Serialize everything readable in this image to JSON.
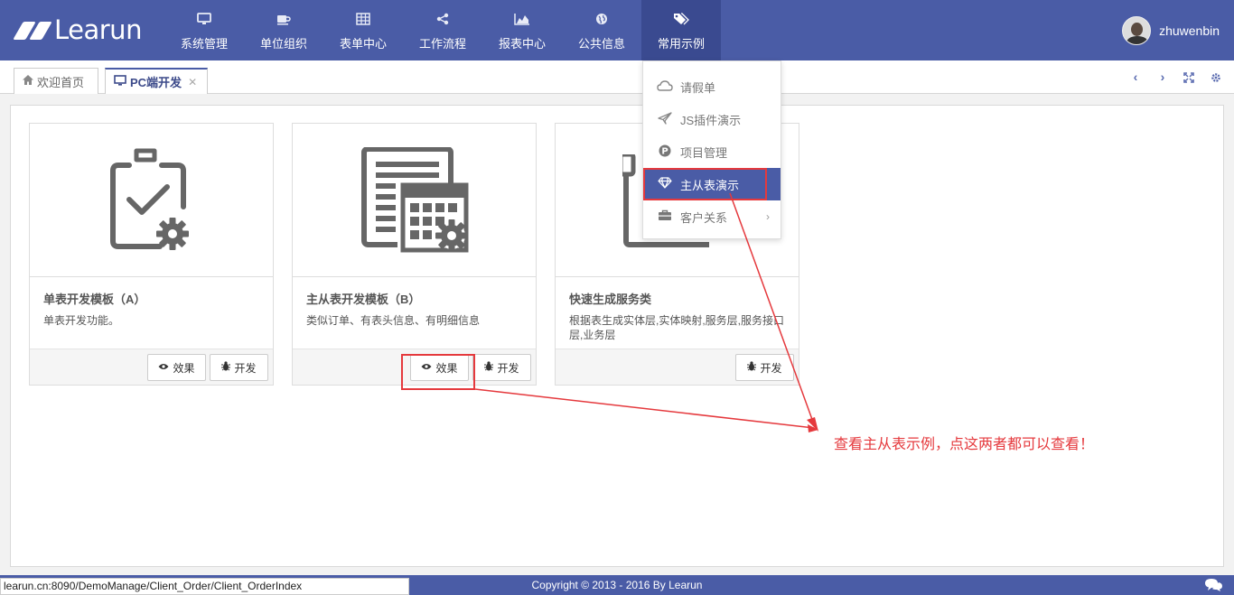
{
  "header": {
    "logo_text": "Learun",
    "user_name": "zhuwenbin",
    "nav": [
      {
        "label": "系统管理",
        "icon": "monitor-icon"
      },
      {
        "label": "单位组织",
        "icon": "coffee-icon"
      },
      {
        "label": "表单中心",
        "icon": "grid-icon"
      },
      {
        "label": "工作流程",
        "icon": "share-icon"
      },
      {
        "label": "报表中心",
        "icon": "area-chart-icon"
      },
      {
        "label": "公共信息",
        "icon": "globe-icon"
      },
      {
        "label": "常用示例",
        "icon": "tags-icon"
      }
    ]
  },
  "tabs": {
    "home": "欢迎首页",
    "pc": "PC端开发"
  },
  "dropdown": {
    "items": [
      {
        "label": "请假单",
        "icon": "cloud-icon"
      },
      {
        "label": "JS插件演示",
        "icon": "paper-plane-icon"
      },
      {
        "label": "项目管理",
        "icon": "p-circle-icon"
      },
      {
        "label": "主从表演示",
        "icon": "diamond-icon"
      },
      {
        "label": "客户关系",
        "icon": "briefcase-icon"
      }
    ]
  },
  "cards": [
    {
      "title": "单表开发模板（A）",
      "desc": "单表开发功能。",
      "effect_label": "效果",
      "dev_label": "开发"
    },
    {
      "title": "主从表开发模板（B）",
      "desc": "类似订单、有表头信息、有明细信息",
      "effect_label": "效果",
      "dev_label": "开发"
    },
    {
      "title": "快速生成服务类",
      "desc": "根据表生成实体层,实体映射,服务层,服务接口层,业务层",
      "dev_label": "开发"
    }
  ],
  "annotation": "查看主从表示例，点这两者都可以查看！",
  "status_url": "learun.cn:8090/DemoManage/Client_Order/Client_OrderIndex",
  "copyright": "Copyright © 2013 - 2016 By Learun",
  "colors": {
    "primary": "#4a5ca6",
    "annotation": "#e5393d"
  }
}
